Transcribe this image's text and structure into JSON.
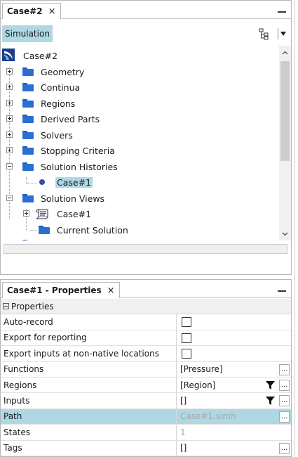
{
  "top_panel": {
    "tab_label": "Case#2",
    "close_glyph": "×",
    "toolbar_button": "Simulation",
    "tree": {
      "root": "Case#2",
      "items": [
        "Geometry",
        "Continua",
        "Regions",
        "Derived Parts",
        "Solvers",
        "Stopping Criteria",
        "Solution Histories"
      ],
      "history_child": "Case#1",
      "views_label": "Solution Views",
      "view_child": "Case#1",
      "current_solution": "Current Solution"
    },
    "icons": [
      "tree-structure-icon",
      "dropdown-arrow-icon",
      "folder-icon",
      "star-logo-icon",
      "scene-icon"
    ]
  },
  "properties_panel": {
    "tab_label": "Case#1 - Properties",
    "close_glyph": "×",
    "group": "Properties",
    "rows": [
      {
        "name": "Auto-record",
        "checked": false
      },
      {
        "name": "Export for reporting",
        "checked": false
      },
      {
        "name": "Export inputs at non-native locations",
        "checked": false
      },
      {
        "name": "Functions",
        "value": "[Pressure]"
      },
      {
        "name": "Regions",
        "value": "[Region]"
      },
      {
        "name": "Inputs",
        "value": "[]"
      },
      {
        "name": "Path",
        "value": "Case#1.simh"
      },
      {
        "name": "States",
        "value": "1"
      },
      {
        "name": "Tags",
        "value": "[]"
      }
    ],
    "ellipsis": "..."
  },
  "colors": {
    "selection": "#aed8e3",
    "folder": "#2a6fd1",
    "dot": "#3b4aa8"
  }
}
